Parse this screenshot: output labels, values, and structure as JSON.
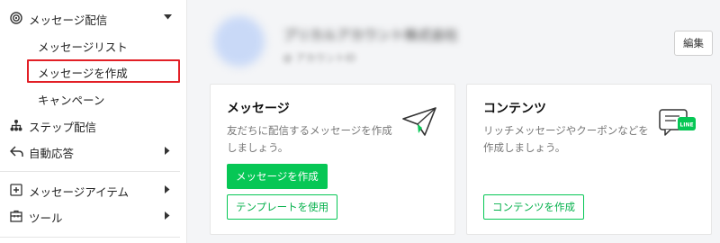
{
  "sidebar": {
    "message_delivery": {
      "label": "メッセージ配信",
      "icon": "broadcast-icon"
    },
    "sub_items": [
      {
        "label": "メッセージリスト"
      },
      {
        "label": "メッセージを作成"
      },
      {
        "label": "キャンペーン"
      }
    ],
    "step_delivery": {
      "label": "ステップ配信",
      "icon": "hierarchy-icon"
    },
    "auto_response": {
      "label": "自動応答",
      "icon": "reply-icon"
    },
    "message_items": {
      "label": "メッセージアイテム",
      "icon": "add-box-icon"
    },
    "tools": {
      "label": "ツール",
      "icon": "toolbox-icon"
    }
  },
  "header": {
    "account_name": "プリカルアカウント株式会社",
    "account_id": "@ アカウントID",
    "edit_label": "編集"
  },
  "cards": {
    "message": {
      "title": "メッセージ",
      "desc_line1": "友だちに配信するメッセージを作成",
      "desc_line2": "しましょう。",
      "primary_button": "メッセージを作成",
      "secondary_button": "テンプレートを使用",
      "icon": "paper-plane-icon"
    },
    "content": {
      "title": "コンテンツ",
      "desc_line1": "リッチメッセージやクーポンなどを",
      "desc_line2": "作成しましょう。",
      "button": "コンテンツを作成",
      "icon": "line-chat-icon",
      "icon_badge": "LINE"
    }
  },
  "colors": {
    "accent_green": "#06c755",
    "selection_red": "#e21f26"
  }
}
